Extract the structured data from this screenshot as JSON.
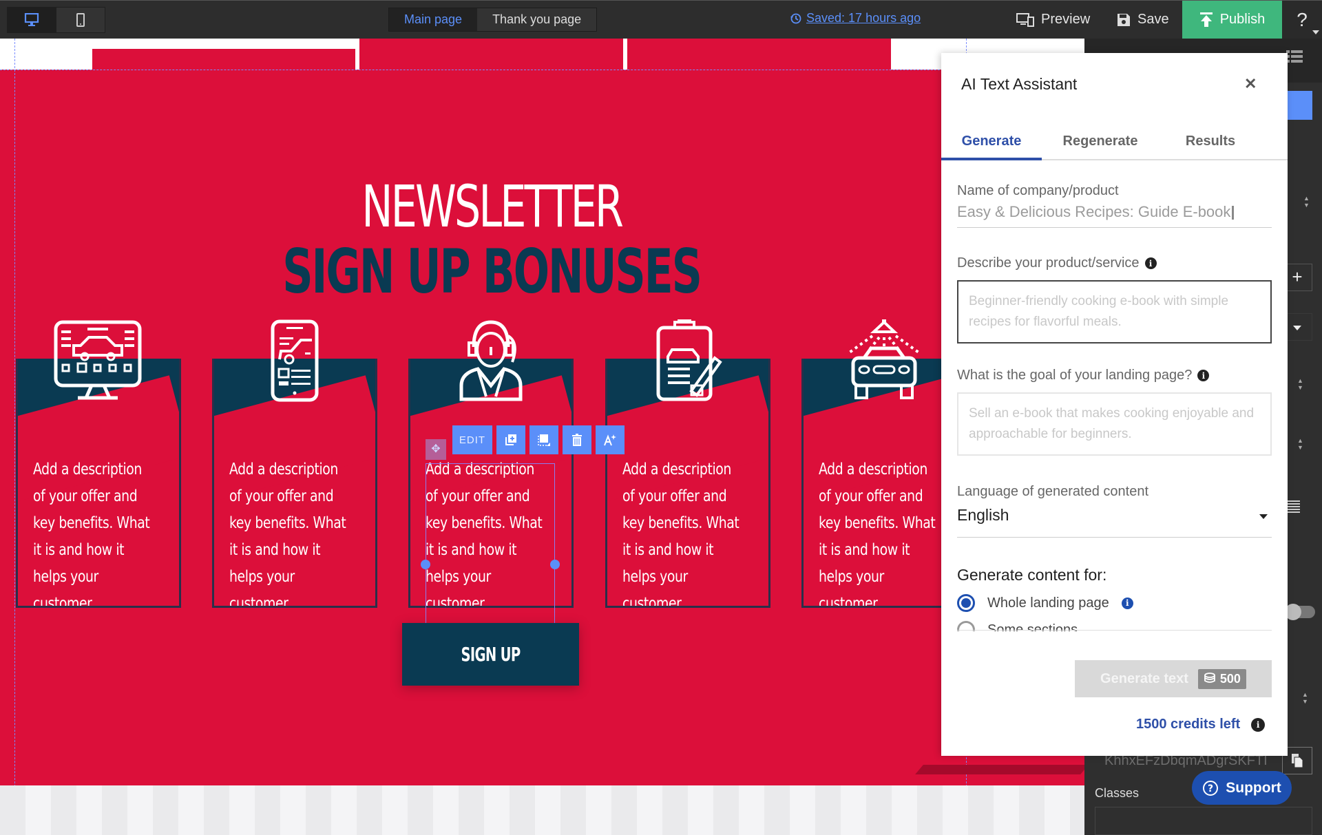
{
  "topbar": {
    "devices": [
      {
        "name": "desktop",
        "active": true
      },
      {
        "name": "mobile",
        "active": false
      }
    ],
    "page_tabs": [
      {
        "label": "Main page",
        "active": true
      },
      {
        "label": "Thank you page",
        "active": false
      }
    ],
    "saved_status": "Saved: 17 hours ago",
    "preview_label": "Preview",
    "save_label": "Save",
    "publish_label": "Publish",
    "help_label": "?"
  },
  "canvas": {
    "heading_line1": "NEWSLETTER",
    "heading_line2": "SIGN UP BONUSES",
    "cards": [
      {
        "icon": "monitor-car-diagnostics-icon",
        "text": "Add a description of your offer and key benefits. What it is and how it helps your customer."
      },
      {
        "icon": "mobile-car-app-icon",
        "text": "Add a description of your offer and key benefits. What it is and how it helps your customer."
      },
      {
        "icon": "support-agent-icon",
        "text": "Add a description of your offer and key benefits. What it is and how it helps your customer."
      },
      {
        "icon": "clipboard-car-checklist-icon",
        "text": "Add a description of your offer and key benefits. What it is and how it helps your customer."
      },
      {
        "icon": "car-wash-icon",
        "text": "Add a description of your offer and key benefits. What it is and how it helps your customer."
      }
    ],
    "signup_label": "SIGN UP",
    "element_toolbar": {
      "edit_label": "EDIT",
      "buttons": [
        "duplicate-icon",
        "background-icon",
        "trash-icon",
        "ai-text-icon"
      ]
    },
    "colors": {
      "section_bg": "#dc0f3a",
      "navy": "#0a3a52",
      "accent": "#5b8ff9"
    }
  },
  "ai_panel": {
    "title": "AI Text Assistant",
    "tabs": [
      {
        "label": "Generate",
        "active": true
      },
      {
        "label": "Regenerate",
        "active": false
      },
      {
        "label": "Results",
        "active": false
      }
    ],
    "name_label": "Name of company/product",
    "name_value": "Easy & Delicious Recipes: Guide E-book",
    "describe_label": "Describe your product/service",
    "describe_placeholder": "Beginner-friendly cooking e-book with simple recipes for flavorful meals.",
    "goal_label": "What is the goal of your landing page?",
    "goal_placeholder": "Sell an e-book that makes cooking enjoyable and approachable for beginners.",
    "language_label": "Language of generated content",
    "language_value": "English",
    "generate_for_label": "Generate content for:",
    "options": [
      {
        "label": "Whole landing page",
        "selected": true
      },
      {
        "label": "Some sections",
        "selected": false
      }
    ],
    "generate_button": "Generate text",
    "generate_cost": "500",
    "credits_left": "1500 credits left"
  },
  "right_sidebar": {
    "element_id": "KhhxEFzDbqmADgrSKFTI",
    "classes_label": "Classes",
    "support_label": "Support"
  }
}
